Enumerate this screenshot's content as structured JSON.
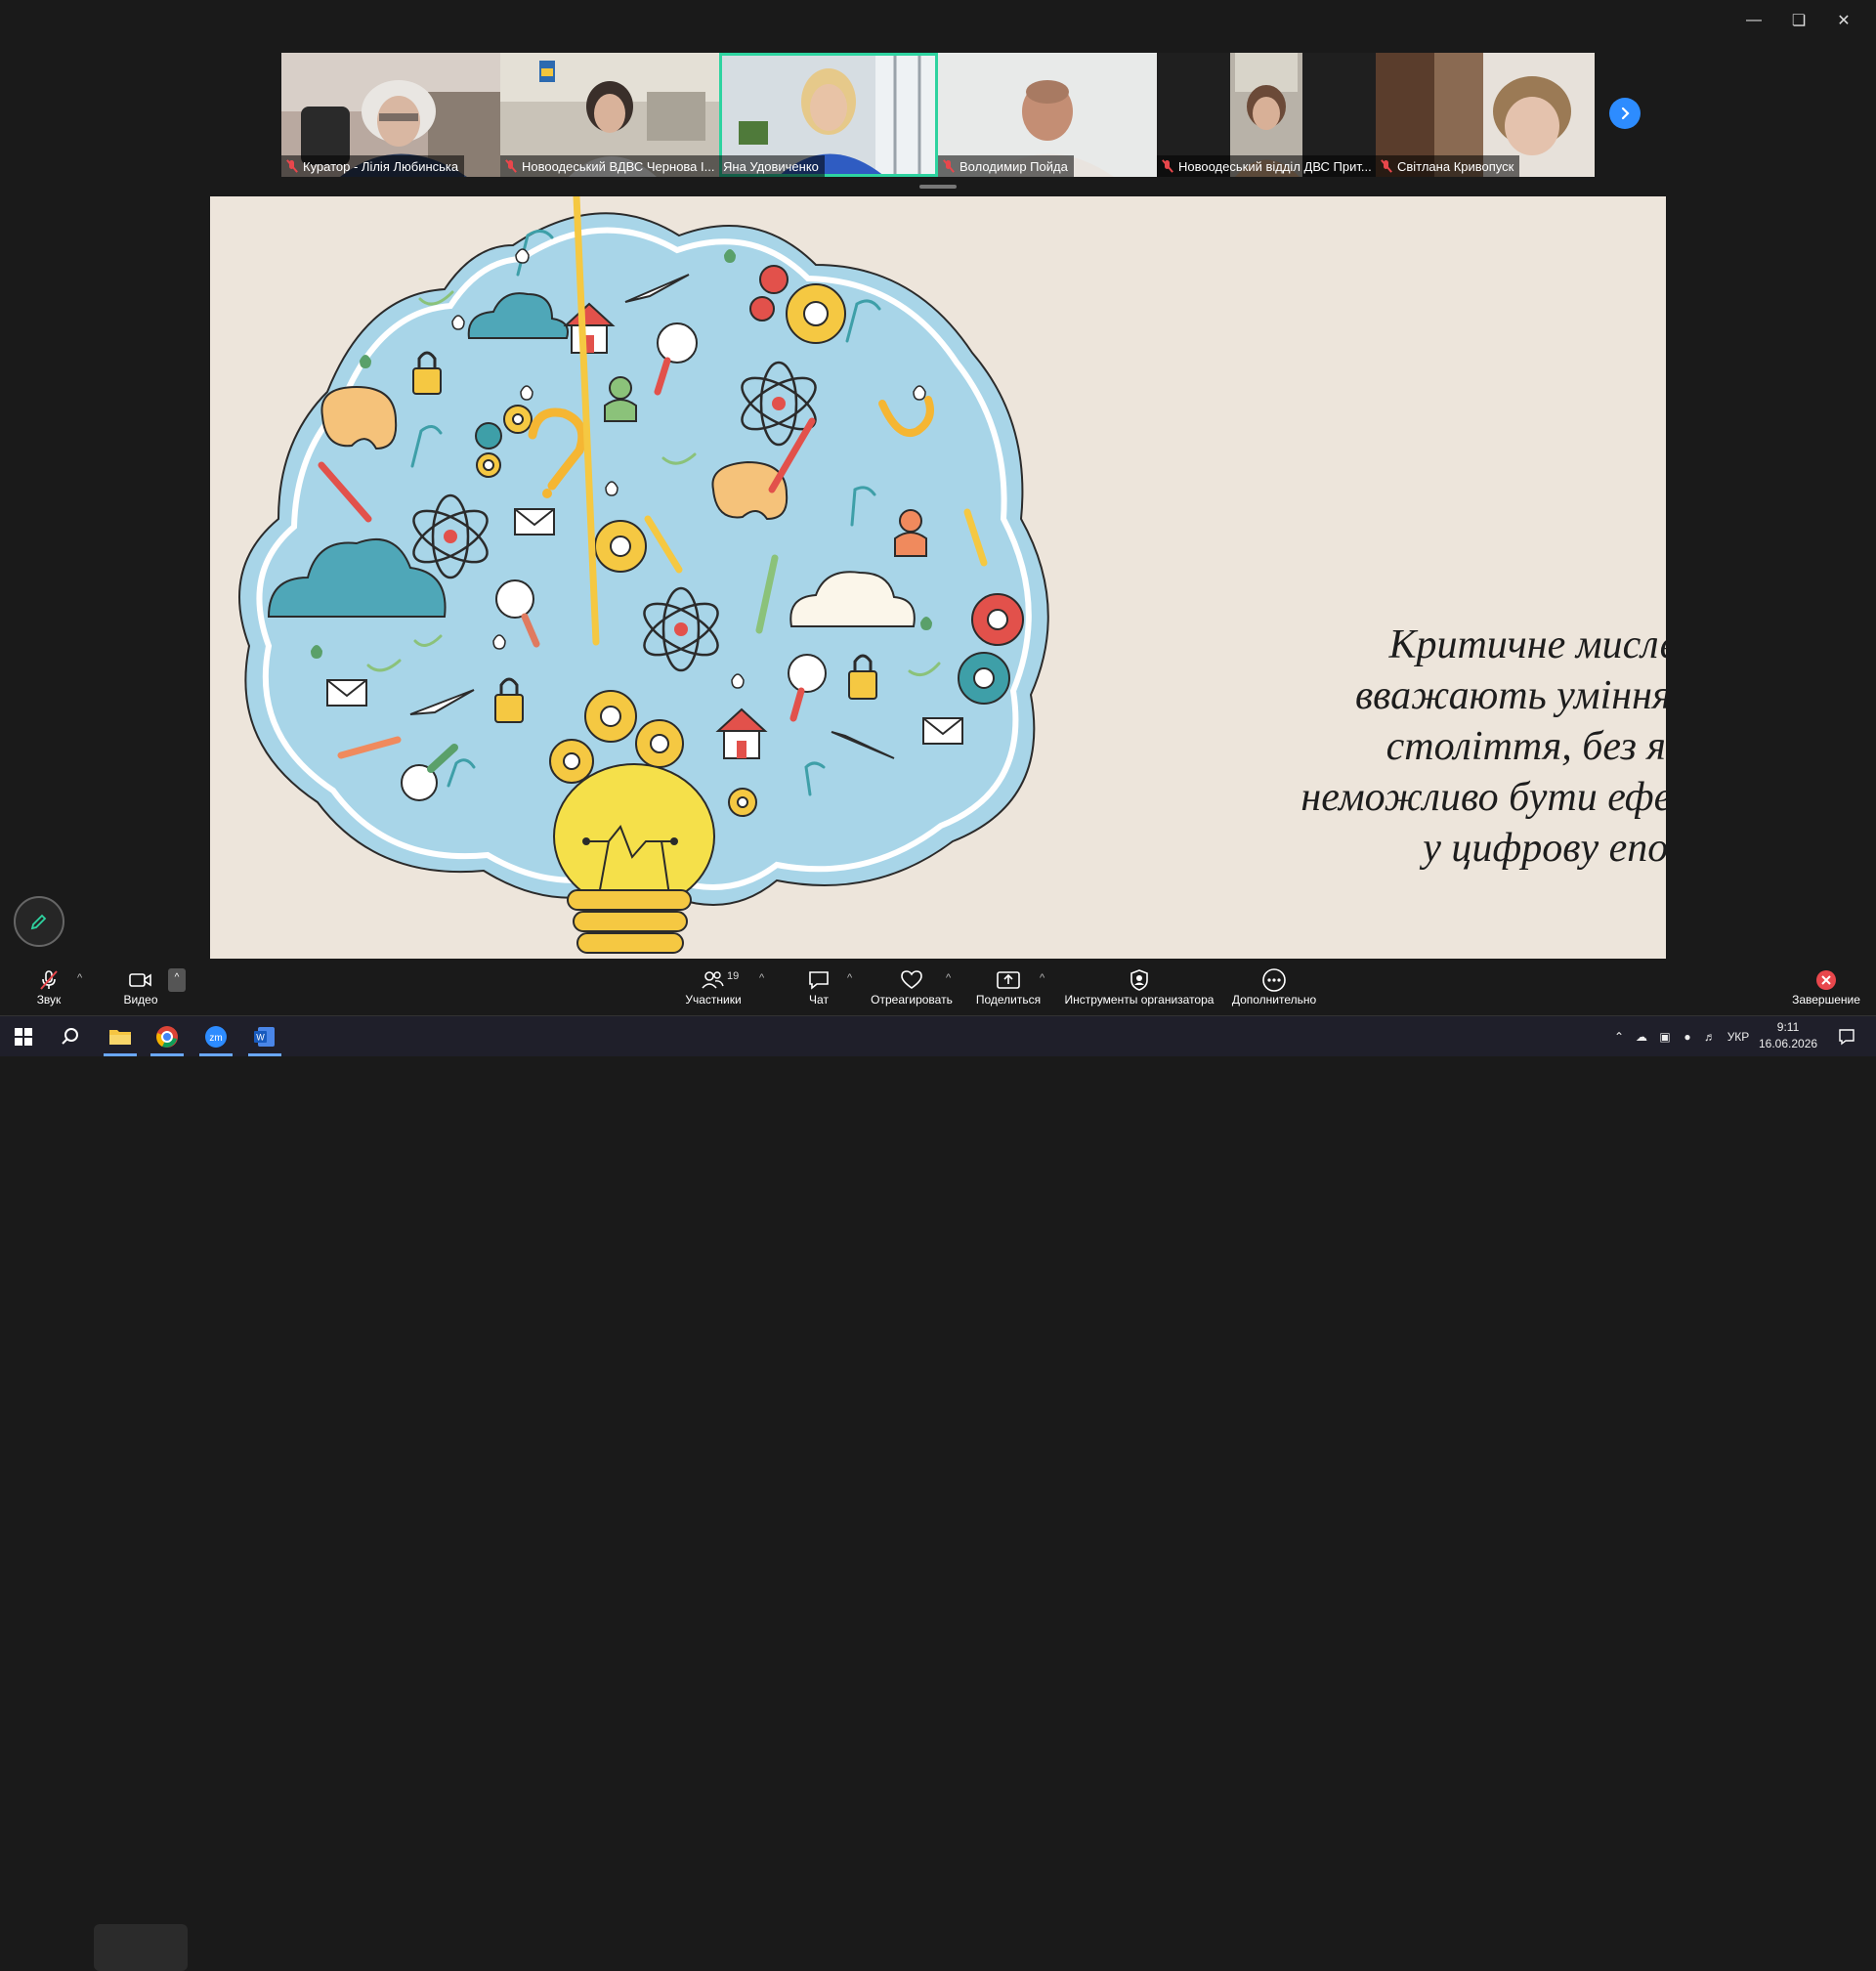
{
  "window": {
    "controls": [
      "minimize",
      "restore",
      "close"
    ]
  },
  "participants_strip": {
    "tiles": [
      {
        "name": "Куратор - Лілія Любинська",
        "muted": true,
        "active": false
      },
      {
        "name": "Новоодеський ВДВС Чернова І...",
        "muted": true,
        "active": false
      },
      {
        "name": "Яна Удовиченко",
        "muted": false,
        "active": true
      },
      {
        "name": "Володимир Пойда",
        "muted": true,
        "active": false
      },
      {
        "name": "Новоодеський відділ ДВС Прит...",
        "muted": true,
        "active": false
      },
      {
        "name": "Світлана Кривопуск",
        "muted": true,
        "active": false
      }
    ],
    "next_icon": "chevron-right-icon"
  },
  "slide": {
    "text": "Критичне мислення вважають умінням XXI століття, без якого неможливо бути ефективним у цифрову епоху"
  },
  "toolbar": {
    "audio_label": "Звук",
    "video_label": "Видео",
    "participants_label": "Участники",
    "participants_count": "19",
    "chat_label": "Чат",
    "react_label": "Отреагировать",
    "share_label": "Поделиться",
    "host_tools_label": "Инструменты организатора",
    "more_label": "Дополнительно",
    "end_label": "Завершение"
  },
  "taskbar": {
    "language": "УКР",
    "time": "9:11",
    "date": "16.06.2026"
  },
  "colors": {
    "accent_blue": "#2d8cff",
    "active_speaker": "#2ed3a0",
    "mute_red": "#e8474c",
    "slide_bg": "#ede5db",
    "cloud_blue": "#a8d5e8"
  }
}
